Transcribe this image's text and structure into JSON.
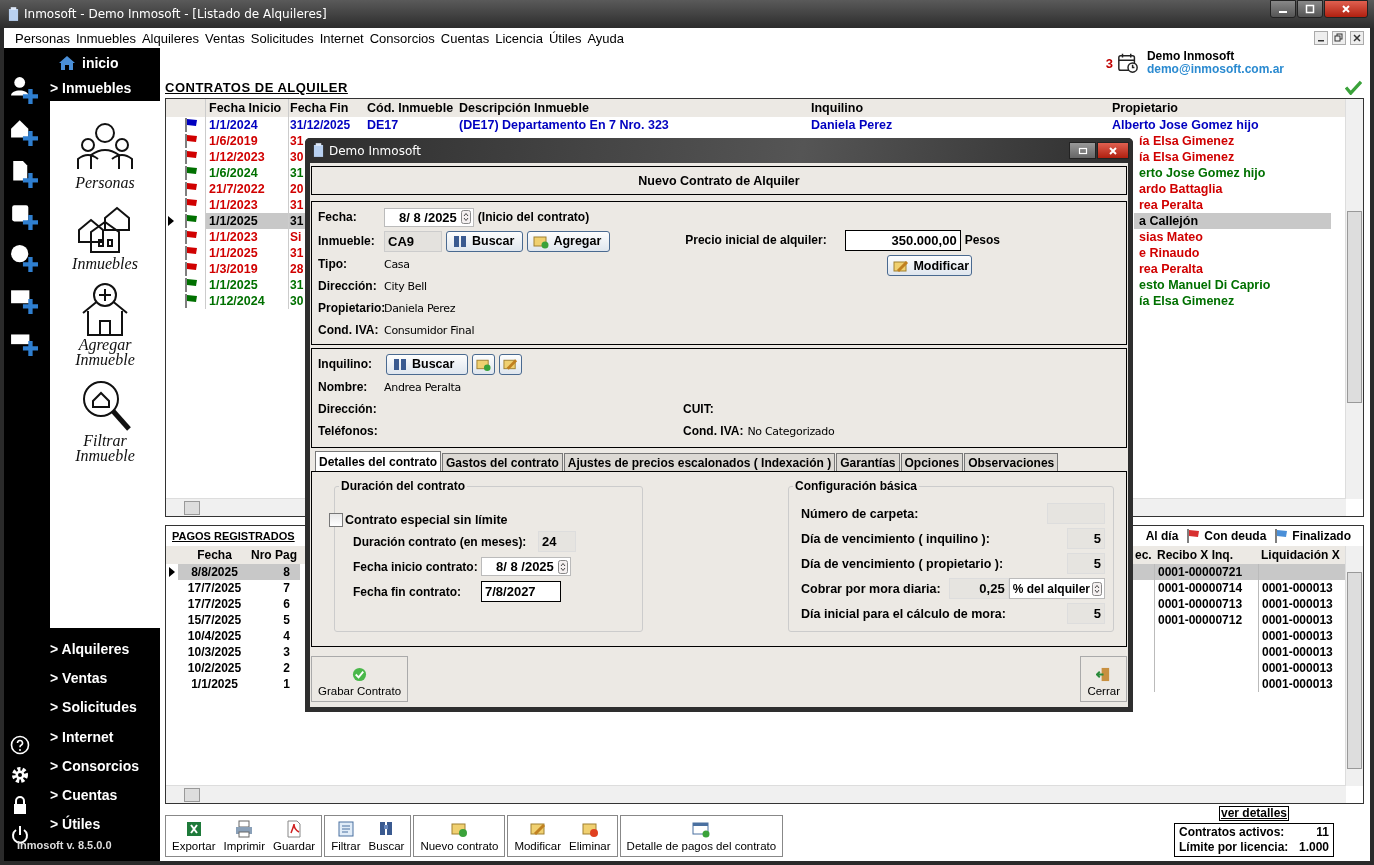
{
  "window": {
    "title": "Inmosoft - Demo Inmosoft - [Listado de Alquileres]"
  },
  "menu": [
    "Personas",
    "Inmuebles",
    "Alquileres",
    "Ventas",
    "Solicitudes",
    "Internet",
    "Consorcios",
    "Cuentas",
    "Licencia",
    "Útiles",
    "Ayuda"
  ],
  "sidebar": {
    "home": "inicio",
    "current": "> Inmuebles",
    "shortcuts": [
      {
        "label": "Personas",
        "kind": "people"
      },
      {
        "label": "Inmuebles",
        "kind": "houses"
      },
      {
        "label": "Agregar Inmueble",
        "kind": "add"
      },
      {
        "label": "Filtrar Inmueble",
        "kind": "filter"
      }
    ],
    "sections": [
      "> Alquileres",
      "> Ventas",
      "> Solicitudes",
      "> Internet",
      "> Consorcios",
      "> Cuentas",
      "> Útiles"
    ],
    "version": "Inmosoft v. 8.5.0.0"
  },
  "header": {
    "reminders": "3",
    "user_name": "Demo Inmosoft",
    "user_email": "demo@inmosoft.com.ar"
  },
  "contracts": {
    "title": "CONTRATOS DE ALQUILER",
    "columns": [
      "Fecha Inicio",
      "Fecha Fin",
      "Cód. Inmueble",
      "Descripción Inmueble",
      "Inquilino",
      "Propietario"
    ],
    "rows": [
      {
        "color": "#0000c0",
        "selected": false,
        "fecha_inicio": "1/1/2024",
        "fecha_fin": "31/12/2025",
        "codigo": "DE17",
        "descripcion": "(DE17) Departamento En 7 Nro. 323",
        "inquilino": "Daniela Perez",
        "propietario": "Alberto Jose Gomez hijo"
      },
      {
        "color": "#d00000",
        "selected": false,
        "fecha_inicio": "1/6/2019",
        "fecha_fin": "31",
        "propietario": "ía Elsa Gimenez"
      },
      {
        "color": "#d00000",
        "selected": false,
        "fecha_inicio": "1/12/2023",
        "fecha_fin": "30",
        "propietario": "ía Elsa Gimenez"
      },
      {
        "color": "#007000",
        "selected": false,
        "fecha_inicio": "1/6/2024",
        "fecha_fin": "31",
        "propietario": "erto Jose Gomez hijo"
      },
      {
        "color": "#d00000",
        "selected": false,
        "fecha_inicio": "21/7/2022",
        "fecha_fin": "20",
        "propietario": "ardo Battaglia"
      },
      {
        "color": "#d00000",
        "selected": false,
        "fecha_inicio": "1/1/2023",
        "fecha_fin": "31",
        "propietario": "rea Peralta"
      },
      {
        "color": "#007000",
        "selected": true,
        "fecha_inicio": "1/1/2025",
        "fecha_fin": "31",
        "propietario": "a Callejón"
      },
      {
        "color": "#d00000",
        "selected": false,
        "fecha_inicio": "1/1/2023",
        "fecha_fin": "Si",
        "propietario": "sias Mateo"
      },
      {
        "color": "#d00000",
        "selected": false,
        "fecha_inicio": "1/1/2025",
        "fecha_fin": "31",
        "propietario": "e Rinaudo"
      },
      {
        "color": "#d00000",
        "selected": false,
        "fecha_inicio": "1/3/2019",
        "fecha_fin": "28",
        "propietario": "rea Peralta"
      },
      {
        "color": "#007000",
        "selected": false,
        "fecha_inicio": "1/1/2025",
        "fecha_fin": "31",
        "propietario": "esto Manuel Di Caprio"
      },
      {
        "color": "#007000",
        "selected": false,
        "fecha_inicio": "1/12/2024",
        "fecha_fin": "30",
        "propietario": "ía Elsa Gimenez"
      }
    ]
  },
  "payments": {
    "title": "PAGOS REGISTRADOS",
    "legend": [
      {
        "label": "Al día",
        "flag_visible": false
      },
      {
        "label": "Con deuda",
        "color": "#d83030",
        "flag_visible": true
      },
      {
        "label": "Finalizado",
        "color": "#4a8fd8",
        "flag_visible": true
      }
    ],
    "columns": [
      "Fecha",
      "Nro Pag",
      "ec.",
      "Recibo X Inq.",
      "Liquidación X"
    ],
    "rows": [
      {
        "selected": true,
        "fecha": "8/8/2025",
        "nro": "8",
        "recibo": "0001-00000721"
      },
      {
        "selected": false,
        "fecha": "17/7/2025",
        "nro": "7",
        "recibo": "0001-00000714",
        "liquidacion": "0001-000013"
      },
      {
        "selected": false,
        "fecha": "17/7/2025",
        "nro": "6",
        "recibo": "0001-00000713",
        "liquidacion": "0001-000013"
      },
      {
        "selected": false,
        "fecha": "15/7/2025",
        "nro": "5",
        "recibo": "0001-00000712",
        "liquidacion": "0001-000013"
      },
      {
        "selected": false,
        "fecha": "10/4/2025",
        "nro": "4",
        "liquidacion": "0001-000013"
      },
      {
        "selected": false,
        "fecha": "10/3/2025",
        "nro": "3",
        "liquidacion": "0001-000013"
      },
      {
        "selected": false,
        "fecha": "10/2/2025",
        "nro": "2",
        "liquidacion": "0001-000013"
      },
      {
        "selected": false,
        "fecha": "1/1/2025",
        "nro": "1",
        "liquidacion": "0001-000013"
      }
    ]
  },
  "toolbar": [
    [
      {
        "label": "Exportar",
        "kind": "excel"
      },
      {
        "label": "Imprimir",
        "kind": "printer"
      },
      {
        "label": "Guardar",
        "kind": "pdf"
      }
    ],
    [
      {
        "label": "Filtrar",
        "kind": "filter"
      },
      {
        "label": "Buscar",
        "kind": "search"
      }
    ],
    [
      {
        "label": "Nuevo contrato",
        "kind": "new"
      }
    ],
    [
      {
        "label": "Modificar",
        "kind": "edit"
      },
      {
        "label": "Eliminar",
        "kind": "delete"
      }
    ],
    [
      {
        "label": "Detalle de pagos del contrato",
        "kind": "detail"
      }
    ]
  ],
  "summary": {
    "link": "ver detalles",
    "rows": [
      {
        "label": "Contratos activos:",
        "value": "11"
      },
      {
        "label": "Límite por licencia:",
        "value": "1.000"
      }
    ]
  },
  "dialog": {
    "title": "Demo Inmosoft",
    "heading": "Nuevo Contrato de Alquiler",
    "property": {
      "fecha_label": "Fecha:",
      "fecha": "8/ 8 /2025",
      "fecha_note": "(Inicio del contrato)",
      "inmueble_label": "Inmueble:",
      "inmueble": "CA9",
      "search_button": "Buscar",
      "add_button": "Agregar",
      "details": [
        {
          "label": "Tipo:",
          "value": "Casa"
        },
        {
          "label": "Dirección:",
          "value": "City Bell"
        },
        {
          "label": "Propietario:",
          "value": "Daniela Perez"
        },
        {
          "label": "Cond. IVA:",
          "value": "Consumidor Final"
        }
      ],
      "price_label": "Precio inicial de alquiler:",
      "price": "350.000,00",
      "currency": "Pesos",
      "modify_button": "Modificar"
    },
    "tenant": {
      "label": "Inquilino:",
      "search_button": "Buscar",
      "name_label": "Nombre:",
      "name": "Andrea Peralta",
      "rows": [
        [
          {
            "label": "Dirección:"
          },
          {
            "label": "CUIT:"
          }
        ],
        [
          {
            "label": "Teléfonos:"
          },
          {
            "label": "Cond. IVA:",
            "value": "No Categorizado"
          }
        ]
      ]
    },
    "tabs": [
      {
        "label": "Detalles del contrato",
        "selected": true
      },
      {
        "label": "Gastos del contrato",
        "selected": false
      },
      {
        "label": "Ajustes de precios escalonados ( Indexación )",
        "selected": false
      },
      {
        "label": "Garantías",
        "selected": false
      },
      {
        "label": "Opciones",
        "selected": false
      },
      {
        "label": "Observaciones",
        "selected": false
      }
    ],
    "duration": {
      "title": "Duración del contrato",
      "special_label": "Contrato especial sin límite",
      "special_checked": false,
      "fields": [
        {
          "label": "Duración contrato (en meses):",
          "value": "24",
          "kind": "short"
        },
        {
          "label": "Fecha inicio contrato:",
          "value": "8/ 8 /2025",
          "kind": "date"
        },
        {
          "label": "Fecha fin contrato:",
          "value": "7/8/2027",
          "kind": "text"
        }
      ]
    },
    "config": {
      "title": "Configuración básica",
      "fields": [
        {
          "label": "Número de carpeta:",
          "kind": "wide"
        },
        {
          "label": "Día de vencimiento ( inquilino ):",
          "value": "5",
          "kind": "short"
        },
        {
          "label": "Día de vencimiento ( propietario ):",
          "value": "5",
          "kind": "short"
        },
        {
          "label": "Cobrar por mora diaria:",
          "value": "0,25",
          "unit": "% del alquiler",
          "kind": "select"
        },
        {
          "label": "Día inicial para el cálculo de mora:",
          "value": "5",
          "kind": "short"
        }
      ]
    },
    "footer": [
      {
        "label": "Grabar Contrato",
        "kind": "save"
      },
      {
        "label": "Cerrar",
        "kind": "close"
      }
    ]
  }
}
